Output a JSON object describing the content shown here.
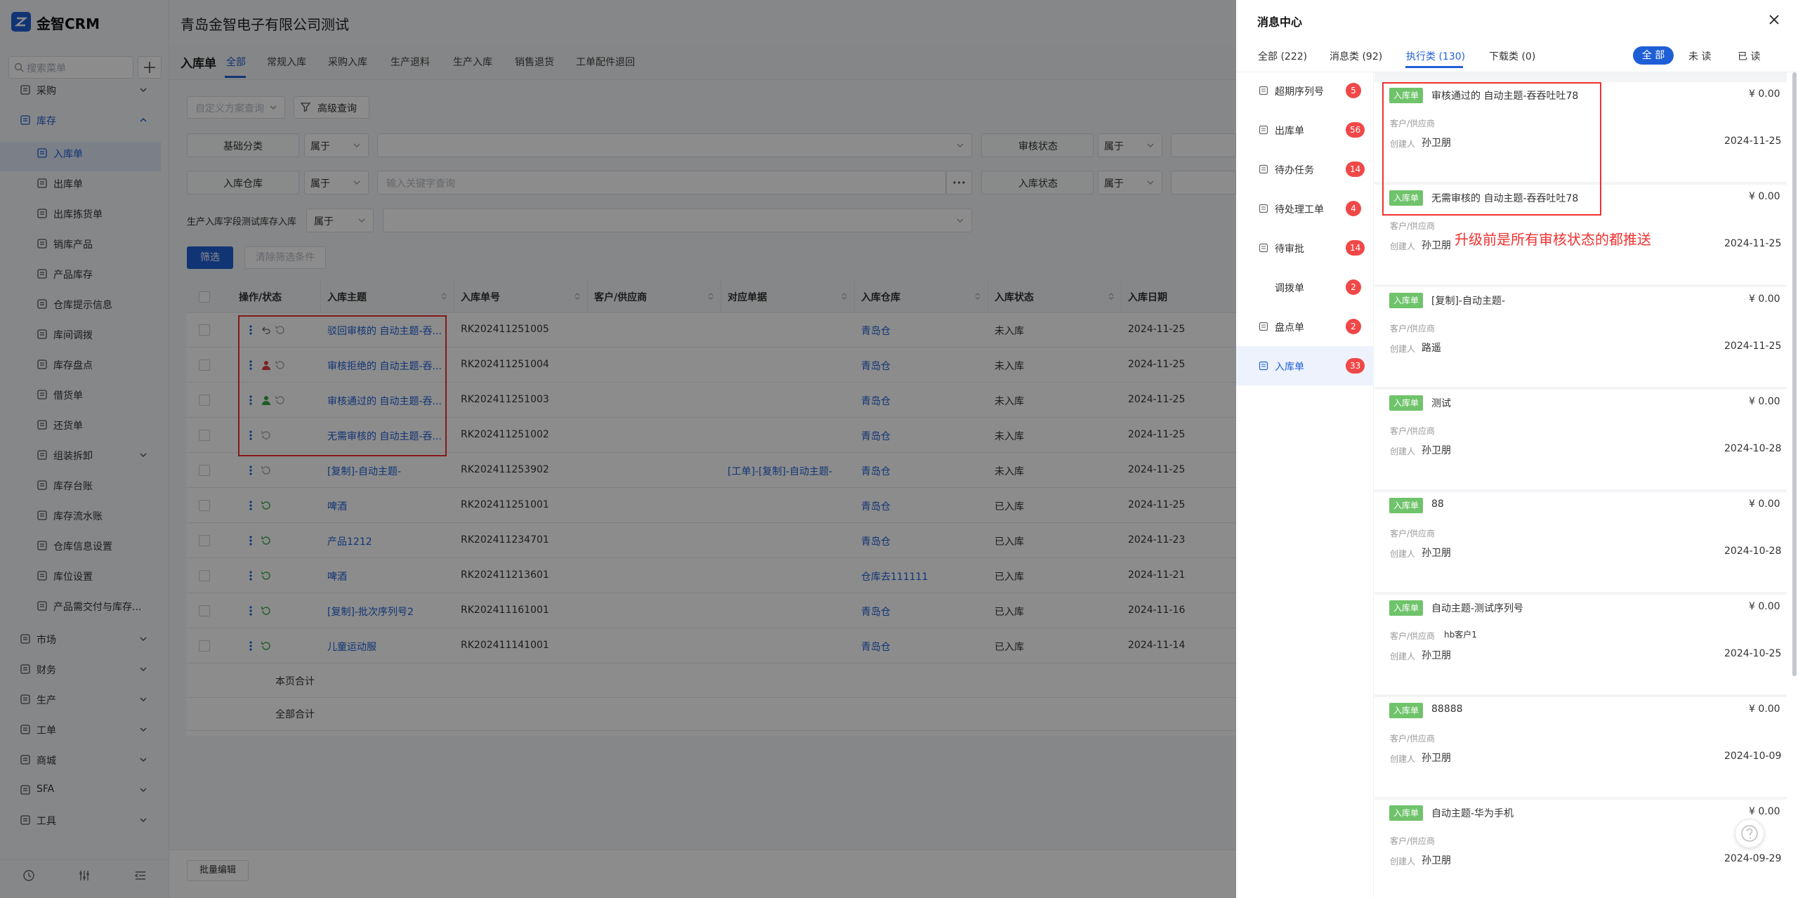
{
  "app": {
    "name": "金智CRM"
  },
  "sidebar": {
    "search_placeholder": "搜索菜单",
    "items": [
      {
        "label": "采购"
      },
      {
        "label": "库存"
      },
      {
        "label": "入库单"
      },
      {
        "label": "出库单"
      },
      {
        "label": "出库拣货单"
      },
      {
        "label": "销库产品"
      },
      {
        "label": "产品库存"
      },
      {
        "label": "仓库提示信息"
      },
      {
        "label": "库间调拨"
      },
      {
        "label": "库存盘点"
      },
      {
        "label": "借货单"
      },
      {
        "label": "还货单"
      },
      {
        "label": "组装拆卸"
      },
      {
        "label": "库存台账"
      },
      {
        "label": "库存流水账"
      },
      {
        "label": "仓库信息设置"
      },
      {
        "label": "库位设置"
      },
      {
        "label": "产品需交付与库存..."
      },
      {
        "label": "市场"
      },
      {
        "label": "财务"
      },
      {
        "label": "生产"
      },
      {
        "label": "工单"
      },
      {
        "label": "商城"
      },
      {
        "label": "SFA"
      },
      {
        "label": "工具"
      }
    ]
  },
  "header": {
    "company": "青岛金智电子有限公司测试"
  },
  "page": {
    "title": "入库单",
    "tabs": [
      "全部",
      "常规入库",
      "采购入库",
      "生产退料",
      "生产入库",
      "销售退货",
      "工单配件退回"
    ]
  },
  "filters": {
    "custom_query": "自定义方案查询",
    "advanced": "高级查询",
    "base_category": "基础分类",
    "belongs": "属于",
    "audit_status": "审核状态",
    "warehouse": "入库仓库",
    "keyword_placeholder": "输入关键字查询",
    "inbound_status": "入库状态",
    "custom_field": "生产入库字段测试库存入库",
    "filter_btn": "筛选",
    "clear_btn": "清除筛选条件"
  },
  "table": {
    "headers": [
      "操作/状态",
      "入库主题",
      "入库单号",
      "客户/供应商",
      "对应单据",
      "入库仓库",
      "入库状态",
      "入库日期"
    ],
    "rows": [
      {
        "subject": "驳回审核的 自动主题-吞...",
        "number": "RK202411251005",
        "ref": "",
        "warehouse": "青岛仓",
        "status": "未入库",
        "date": "2024-11-25"
      },
      {
        "subject": "审核拒绝的 自动主题-吞...",
        "number": "RK202411251004",
        "ref": "",
        "warehouse": "青岛仓",
        "status": "未入库",
        "date": "2024-11-25"
      },
      {
        "subject": "审核通过的 自动主题-吞...",
        "number": "RK202411251003",
        "ref": "",
        "warehouse": "青岛仓",
        "status": "未入库",
        "date": "2024-11-25"
      },
      {
        "subject": "无需审核的 自动主题-吞...",
        "number": "RK202411251002",
        "ref": "",
        "warehouse": "青岛仓",
        "status": "未入库",
        "date": "2024-11-25"
      },
      {
        "subject": "[复制]-自动主题-",
        "number": "RK202411253902",
        "ref": "[工单]-[复制]-自动主题-",
        "warehouse": "青岛仓",
        "status": "未入库",
        "date": "2024-11-25"
      },
      {
        "subject": "啤酒",
        "number": "RK202411251001",
        "ref": "",
        "warehouse": "青岛仓",
        "status": "已入库",
        "date": "2024-11-25"
      },
      {
        "subject": "产品1212",
        "number": "RK202411234701",
        "ref": "",
        "warehouse": "青岛仓",
        "status": "已入库",
        "date": "2024-11-23"
      },
      {
        "subject": "啤酒",
        "number": "RK202411213601",
        "ref": "",
        "warehouse": "仓库去111111",
        "status": "已入库",
        "date": "2024-11-21"
      },
      {
        "subject": "[复制]-批次序列号2",
        "number": "RK202411161001",
        "ref": "",
        "warehouse": "青岛仓",
        "status": "已入库",
        "date": "2024-11-16"
      },
      {
        "subject": "儿童运动服",
        "number": "RK202411141001",
        "ref": "",
        "warehouse": "青岛仓",
        "status": "已入库",
        "date": "2024-11-14"
      }
    ],
    "page_total": "本页合计",
    "all_total": "全部合计",
    "batch_edit": "批量编辑"
  },
  "panel": {
    "title": "消息中心",
    "tabs": [
      "全部 (222)",
      "消息类 (92)",
      "执行类 (130)",
      "下载类 (0)"
    ],
    "read_filters": [
      "全 部",
      "未 读",
      "已 读"
    ],
    "categories": [
      {
        "label": "超期序列号",
        "count": "5"
      },
      {
        "label": "出库单",
        "count": "56"
      },
      {
        "label": "待办任务",
        "count": "14"
      },
      {
        "label": "待处理工单",
        "count": "4"
      },
      {
        "label": "待审批",
        "count": "14"
      },
      {
        "label": "调拨单",
        "count": "2"
      },
      {
        "label": "盘点单",
        "count": "2"
      },
      {
        "label": "入库单",
        "count": "33"
      }
    ],
    "labels": {
      "customer": "客户/供应商",
      "creator": "创建人"
    },
    "messages": [
      {
        "tag": "入库单",
        "title": "审核通过的 自动主题-吞吞吐吐78",
        "amount": "¥ 0.00",
        "customer": "",
        "creator": "孙卫朋",
        "date": "2024-11-25"
      },
      {
        "tag": "入库单",
        "title": "无需审核的 自动主题-吞吞吐吐78",
        "amount": "¥ 0.00",
        "customer": "",
        "creator": "孙卫朋",
        "date": "2024-11-25"
      },
      {
        "tag": "入库单",
        "title": "[复制]-自动主题-",
        "amount": "¥ 0.00",
        "customer": "",
        "creator": "路遥",
        "date": "2024-11-25"
      },
      {
        "tag": "入库单",
        "title": "测试",
        "amount": "¥ 0.00",
        "customer": "",
        "creator": "孙卫朋",
        "date": "2024-10-28"
      },
      {
        "tag": "入库单",
        "title": "88",
        "amount": "¥ 0.00",
        "customer": "",
        "creator": "孙卫朋",
        "date": "2024-10-28"
      },
      {
        "tag": "入库单",
        "title": "自动主题-测试序列号",
        "amount": "¥ 0.00",
        "customer": "hb客户1",
        "creator": "孙卫朋",
        "date": "2024-10-25"
      },
      {
        "tag": "入库单",
        "title": "88888",
        "amount": "¥ 0.00",
        "customer": "",
        "creator": "孙卫朋",
        "date": "2024-10-09"
      },
      {
        "tag": "入库单",
        "title": "自动主题-华为手机",
        "amount": "¥ 0.00",
        "customer": "",
        "creator": "孙卫朋",
        "date": "2024-09-29"
      }
    ],
    "annotation": "升级前是所有审核状态的都推送"
  },
  "colors": {
    "primary": "#1f5fd6",
    "badge": "#f04848",
    "tag": "#6fc36a",
    "annotation": "#f0312f"
  }
}
